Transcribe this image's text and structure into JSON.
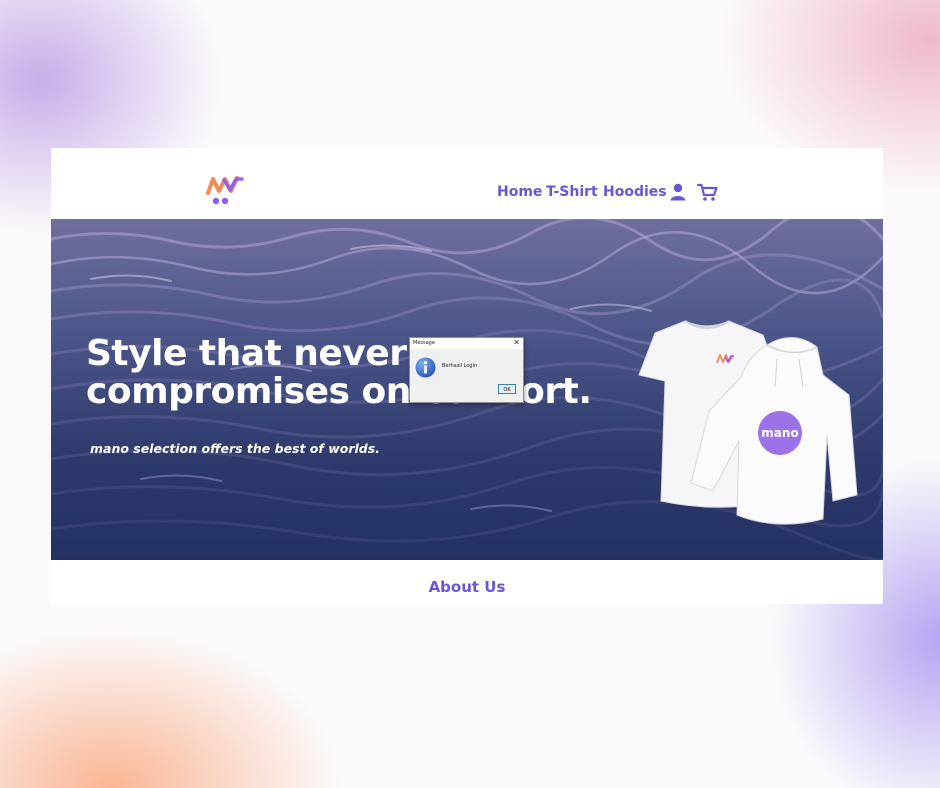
{
  "nav": {
    "links": [
      "Home",
      "T-Shirt",
      "Hoodies"
    ],
    "icons": [
      "user-icon",
      "cart-icon"
    ],
    "logo": "mano-logo"
  },
  "hero": {
    "headline_line1": "Style that never",
    "headline_line2": "compromises on comfort.",
    "tagline": "mano selection offers the best of worlds.",
    "hoodie_print": "mano"
  },
  "section": {
    "about_title": "About Us"
  },
  "dialog": {
    "title": "Message",
    "message": "Berhasil Login",
    "ok_label": "OK",
    "icon": "info-icon"
  },
  "colors": {
    "accent": "#6b55d6",
    "hero_water": "#3a4472",
    "logo_orange": "#f08a5d",
    "logo_purple": "#8a5cf0"
  }
}
